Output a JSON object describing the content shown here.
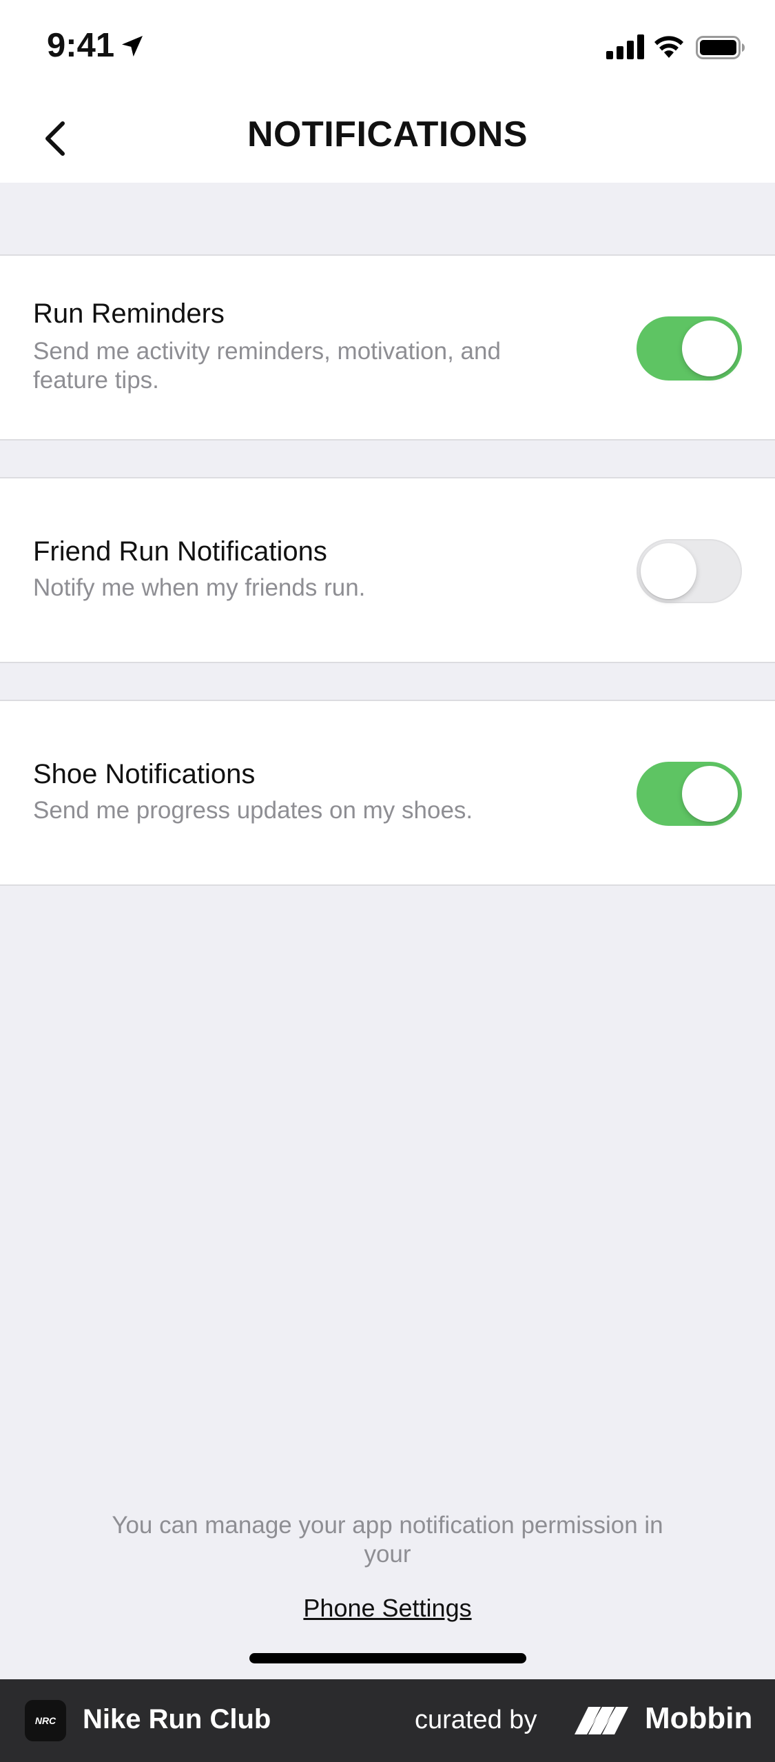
{
  "status_bar": {
    "time": "9:41",
    "icons": [
      "location-arrow-icon",
      "cellular-signal-icon",
      "wifi-icon",
      "battery-icon"
    ]
  },
  "nav": {
    "title": "NOTIFICATIONS",
    "back_icon": "chevron-left-icon"
  },
  "settings": [
    {
      "title": "Run Reminders",
      "description": "Send me activity reminders, motivation, and feature tips.",
      "enabled": true
    },
    {
      "title": "Friend Run Notifications",
      "description": "Notify me when my friends run.",
      "enabled": false
    },
    {
      "title": "Shoe Notifications",
      "description": "Send me progress updates on my shoes.",
      "enabled": true
    }
  ],
  "footer": {
    "note": "You can manage your app notification permission in your",
    "link": "Phone Settings"
  },
  "brand_bar": {
    "app_logo_text": "NRC",
    "app_name": "Nike Run Club",
    "curated_by": "curated by",
    "mobbin": "Mobbin"
  },
  "colors": {
    "toggle_on": "#5ec463",
    "toggle_off": "#e9e9eb",
    "background": "#efeff4",
    "secondary_text": "#8e8e93"
  }
}
